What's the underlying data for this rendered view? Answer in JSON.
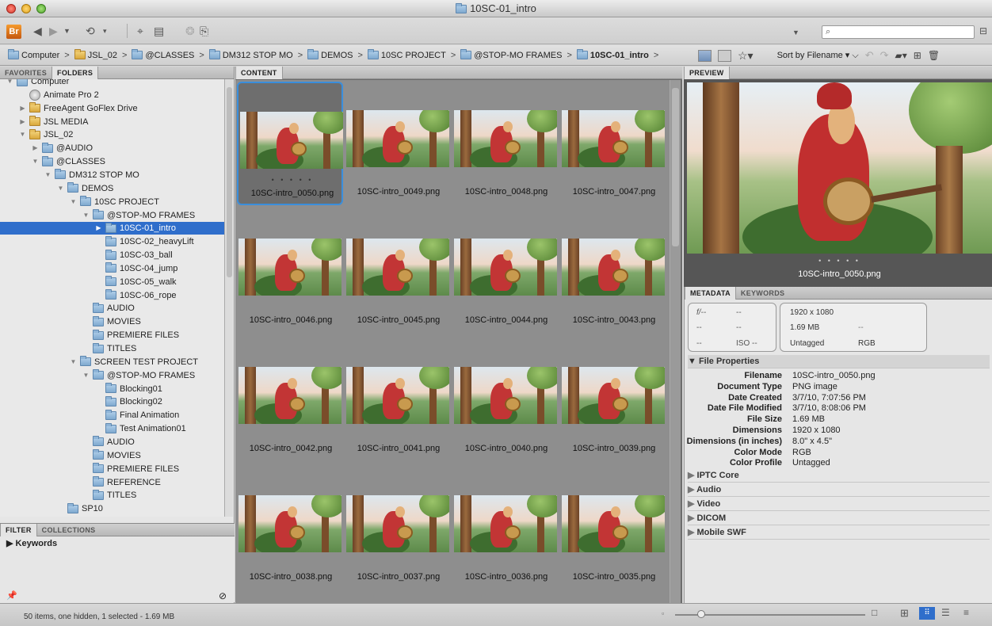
{
  "window": {
    "title": "10SC-01_intro"
  },
  "toolbar": {
    "app_badge": "Br",
    "sort_label": "Sort by Filename",
    "search_placeholder": ""
  },
  "breadcrumb": [
    {
      "label": "Computer",
      "icon": "folder-icon"
    },
    {
      "label": "JSL_02",
      "icon": "drive-icon"
    },
    {
      "label": "@CLASSES",
      "icon": "folder-icon"
    },
    {
      "label": "DM312 STOP MO",
      "icon": "folder-icon"
    },
    {
      "label": "DEMOS",
      "icon": "folder-icon"
    },
    {
      "label": "10SC PROJECT",
      "icon": "folder-icon"
    },
    {
      "label": "@STOP-MO FRAMES",
      "icon": "folder-icon"
    },
    {
      "label": "10SC-01_intro",
      "icon": "folder-icon",
      "bold": true
    }
  ],
  "left_tabs": [
    "FAVORITES",
    "FOLDERS"
  ],
  "folder_tree": [
    {
      "label": "Computer",
      "depth": 1,
      "expanded": true,
      "type": "folder"
    },
    {
      "label": "Animate Pro 2",
      "depth": 2,
      "type": "disc"
    },
    {
      "label": "FreeAgent GoFlex Drive",
      "depth": 2,
      "type": "drive",
      "collapsed": true
    },
    {
      "label": "JSL MEDIA",
      "depth": 2,
      "type": "drive",
      "collapsed": true
    },
    {
      "label": "JSL_02",
      "depth": 2,
      "type": "drive",
      "expanded": true
    },
    {
      "label": "@AUDIO",
      "depth": 3,
      "type": "folder",
      "collapsed": true
    },
    {
      "label": "@CLASSES",
      "depth": 3,
      "type": "folder",
      "expanded": true
    },
    {
      "label": "DM312 STOP MO",
      "depth": 4,
      "type": "folder",
      "expanded": true
    },
    {
      "label": "DEMOS",
      "depth": 5,
      "type": "folder",
      "expanded": true
    },
    {
      "label": "10SC PROJECT",
      "depth": 6,
      "type": "folder",
      "expanded": true
    },
    {
      "label": "@STOP-MO FRAMES",
      "depth": 7,
      "type": "folder",
      "expanded": true
    },
    {
      "label": "10SC-01_intro",
      "depth": 8,
      "type": "folder",
      "selected": true,
      "collapsed": true
    },
    {
      "label": "10SC-02_heavyLift",
      "depth": 8,
      "type": "folder"
    },
    {
      "label": "10SC-03_ball",
      "depth": 8,
      "type": "folder"
    },
    {
      "label": "10SC-04_jump",
      "depth": 8,
      "type": "folder"
    },
    {
      "label": "10SC-05_walk",
      "depth": 8,
      "type": "folder"
    },
    {
      "label": "10SC-06_rope",
      "depth": 8,
      "type": "folder"
    },
    {
      "label": "AUDIO",
      "depth": 7,
      "type": "folder"
    },
    {
      "label": "MOVIES",
      "depth": 7,
      "type": "folder"
    },
    {
      "label": "PREMIERE FILES",
      "depth": 7,
      "type": "folder"
    },
    {
      "label": "TITLES",
      "depth": 7,
      "type": "folder"
    },
    {
      "label": "SCREEN TEST PROJECT",
      "depth": 6,
      "type": "folder",
      "expanded": true
    },
    {
      "label": "@STOP-MO FRAMES",
      "depth": 7,
      "type": "folder",
      "expanded": true
    },
    {
      "label": "Blocking01",
      "depth": 8,
      "type": "folder"
    },
    {
      "label": "Blocking02",
      "depth": 8,
      "type": "folder"
    },
    {
      "label": "Final Animation",
      "depth": 8,
      "type": "folder"
    },
    {
      "label": "Test Animation01",
      "depth": 8,
      "type": "folder"
    },
    {
      "label": "AUDIO",
      "depth": 7,
      "type": "folder"
    },
    {
      "label": "MOVIES",
      "depth": 7,
      "type": "folder"
    },
    {
      "label": "PREMIERE FILES",
      "depth": 7,
      "type": "folder"
    },
    {
      "label": "REFERENCE",
      "depth": 7,
      "type": "folder"
    },
    {
      "label": "TITLES",
      "depth": 7,
      "type": "folder"
    },
    {
      "label": "SP10",
      "depth": 5,
      "type": "folder"
    }
  ],
  "filter_tabs": [
    "FILTER",
    "COLLECTIONS"
  ],
  "filter": {
    "keywords_label": "Keywords"
  },
  "content": {
    "tab": "CONTENT",
    "files": [
      "10SC-intro_0050.png",
      "10SC-intro_0049.png",
      "10SC-intro_0048.png",
      "10SC-intro_0047.png",
      "10SC-intro_0046.png",
      "10SC-intro_0045.png",
      "10SC-intro_0044.png",
      "10SC-intro_0043.png",
      "10SC-intro_0042.png",
      "10SC-intro_0041.png",
      "10SC-intro_0040.png",
      "10SC-intro_0039.png",
      "10SC-intro_0038.png",
      "10SC-intro_0037.png",
      "10SC-intro_0036.png",
      "10SC-intro_0035.png"
    ],
    "rating_dots": "• • • • •"
  },
  "preview": {
    "tab": "PREVIEW",
    "filename": "10SC-intro_0050.png",
    "rating_dots": "• • • • •"
  },
  "metadata_tabs": [
    "METADATA",
    "KEYWORDS"
  ],
  "camera_info": {
    "aperture": "f/--",
    "shutter": "--",
    "a": "--",
    "b": "--",
    "c": "--",
    "iso": "ISO --",
    "dimensions": "1920 x 1080",
    "size": "1.69 MB",
    "size_extra": "--",
    "color_label": "Untagged",
    "color_mode": "RGB"
  },
  "file_properties_title": "File Properties",
  "file_properties": [
    {
      "key": "Filename",
      "value": "10SC-intro_0050.png"
    },
    {
      "key": "Document Type",
      "value": "PNG image"
    },
    {
      "key": "Date Created",
      "value": "3/7/10, 7:07:56 PM"
    },
    {
      "key": "Date File Modified",
      "value": "3/7/10, 8:08:06 PM"
    },
    {
      "key": "File Size",
      "value": "1.69 MB"
    },
    {
      "key": "Dimensions",
      "value": "1920 x 1080"
    },
    {
      "key": "Dimensions (in inches)",
      "value": "8.0\" x 4.5\""
    },
    {
      "key": "Color Mode",
      "value": "RGB"
    },
    {
      "key": "Color Profile",
      "value": "Untagged"
    }
  ],
  "collapsed_sections": [
    "IPTC Core",
    "Audio",
    "Video",
    "DICOM",
    "Mobile SWF"
  ],
  "status": {
    "text": "50 items, one hidden, 1 selected - 1.69 MB"
  },
  "colors": {
    "selection": "#2f6ecb",
    "thumb_border": "#3a8edc",
    "content_bg": "#8e8e8e"
  }
}
